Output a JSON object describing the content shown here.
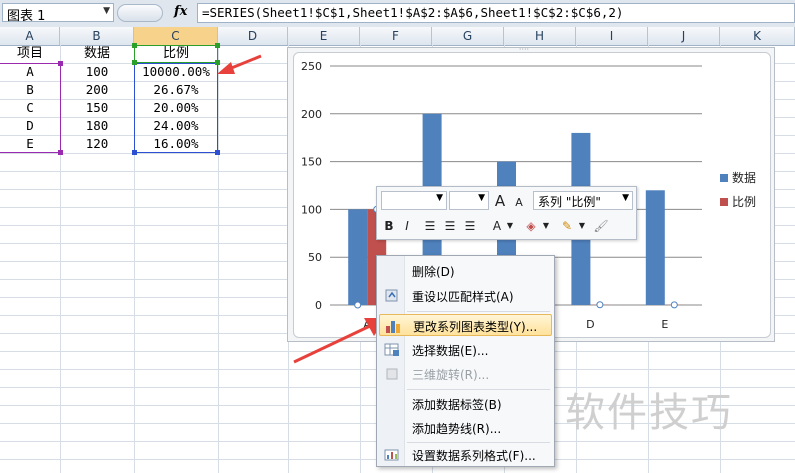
{
  "formula_bar": {
    "name_box": "图表 1",
    "fx": "fx",
    "formula": "=SERIES(Sheet1!$C$1,Sheet1!$A$2:$A$6,Sheet1!$C$2:$C$6,2)"
  },
  "columns": [
    "A",
    "B",
    "C",
    "D",
    "E",
    "F",
    "G",
    "H",
    "I",
    "J",
    "K"
  ],
  "sheet": {
    "headers": [
      "项目",
      "数据",
      "比例"
    ],
    "rows": [
      {
        "item": "A",
        "value": "100",
        "ratio": "10000.00%"
      },
      {
        "item": "B",
        "value": "200",
        "ratio": "26.67%"
      },
      {
        "item": "C",
        "value": "150",
        "ratio": "20.00%"
      },
      {
        "item": "D",
        "value": "180",
        "ratio": "24.00%"
      },
      {
        "item": "E",
        "value": "120",
        "ratio": "16.00%"
      }
    ]
  },
  "chart_data": {
    "type": "bar",
    "categories": [
      "A",
      "B",
      "C",
      "D",
      "E"
    ],
    "series": [
      {
        "name": "数据",
        "values": [
          100,
          200,
          150,
          180,
          120
        ],
        "color": "#4f81bd"
      },
      {
        "name": "比例",
        "values": [
          100,
          0.2667,
          0.2,
          0.24,
          0.16
        ],
        "color": "#c0504d"
      }
    ],
    "ylim": [
      0,
      250
    ],
    "yticks": [
      "0",
      "50",
      "100",
      "150",
      "200",
      "250"
    ],
    "legend": "right",
    "grid": true
  },
  "mini_toolbar": {
    "series_label": "系列 \"比例\"",
    "bold": "B",
    "italic": "I",
    "grow_font": "A",
    "shrink_font": "A",
    "font_color": "A"
  },
  "context_menu": {
    "items": [
      {
        "label": "删除(D)",
        "enabled": true
      },
      {
        "label": "重设以匹配样式(A)",
        "enabled": true
      },
      {
        "label": "更改系列图表类型(Y)...",
        "enabled": true,
        "highlighted": true
      },
      {
        "label": "选择数据(E)...",
        "enabled": true
      },
      {
        "label": "三维旋转(R)...",
        "enabled": false
      },
      {
        "label": "添加数据标签(B)",
        "enabled": true
      },
      {
        "label": "添加趋势线(R)...",
        "enabled": true
      },
      {
        "label": "设置数据系列格式(F)...",
        "enabled": true
      }
    ]
  },
  "watermark": "软件技巧",
  "colors": {
    "accent_arrow": "#e8413c",
    "series1": "#4f81bd",
    "series2": "#c0504d"
  }
}
